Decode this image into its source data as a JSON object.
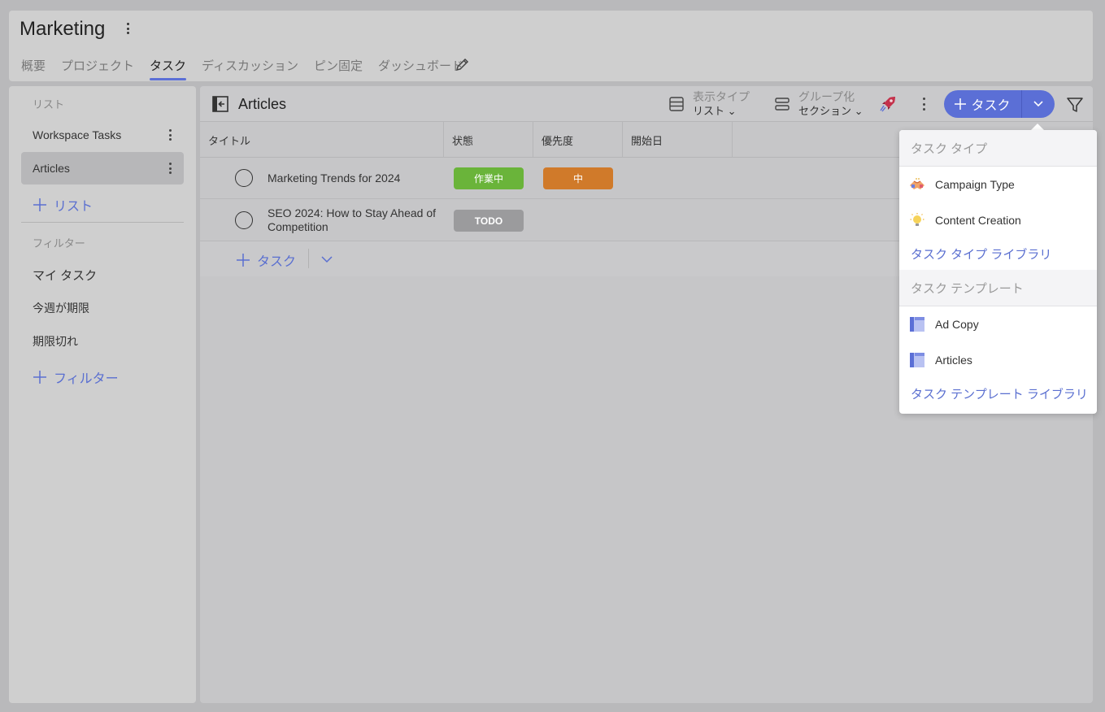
{
  "header": {
    "title": "Marketing",
    "tabs": [
      {
        "label": "概要",
        "active": false
      },
      {
        "label": "プロジェクト",
        "active": false
      },
      {
        "label": "タスク",
        "active": true
      },
      {
        "label": "ディスカッション",
        "active": false
      },
      {
        "label": "ピン固定",
        "active": false
      },
      {
        "label": "ダッシュボード",
        "active": false
      }
    ]
  },
  "sidebar": {
    "lists_label": "リスト",
    "lists": [
      {
        "label": "Workspace Tasks",
        "selected": false
      },
      {
        "label": "Articles",
        "selected": true
      }
    ],
    "add_list_label": "リスト",
    "filters_label": "フィルター",
    "filters": [
      {
        "label": "マイ タスク"
      },
      {
        "label": "今週が期限"
      },
      {
        "label": "期限切れ"
      }
    ],
    "add_filter_label": "フィルター"
  },
  "toolbar": {
    "list_title": "Articles",
    "view_type_label": "表示タイプ",
    "view_type_value": "リスト",
    "group_label": "グループ化",
    "group_value": "セクション",
    "add_task_label": "タスク"
  },
  "table": {
    "columns": [
      "タイトル",
      "状態",
      "優先度",
      "開始日"
    ],
    "rows": [
      {
        "title": "Marketing Trends for 2024",
        "status": "作業中",
        "priority": "中"
      },
      {
        "title": "SEO 2024: How to Stay Ahead of Competition",
        "status": "TODO",
        "priority": ""
      }
    ],
    "add_task_label": "タスク"
  },
  "dropdown": {
    "task_type_header": "タスク タイプ",
    "task_types": [
      {
        "label": "Campaign Type",
        "icon": "handshake-icon"
      },
      {
        "label": "Content Creation",
        "icon": "lightbulb-icon"
      }
    ],
    "task_type_library": "タスク タイプ ライブラリ",
    "template_header": "タスク テンプレート",
    "templates": [
      {
        "label": "Ad Copy",
        "icon": "template-icon"
      },
      {
        "label": "Articles",
        "icon": "template-icon"
      }
    ],
    "template_library": "タスク テンプレート ライブラリ"
  },
  "colors": {
    "accent": "#5b6fd6",
    "status_in_progress": "#6ab43a",
    "priority_medium": "#d07a2a",
    "status_todo": "#9b9b9d"
  }
}
